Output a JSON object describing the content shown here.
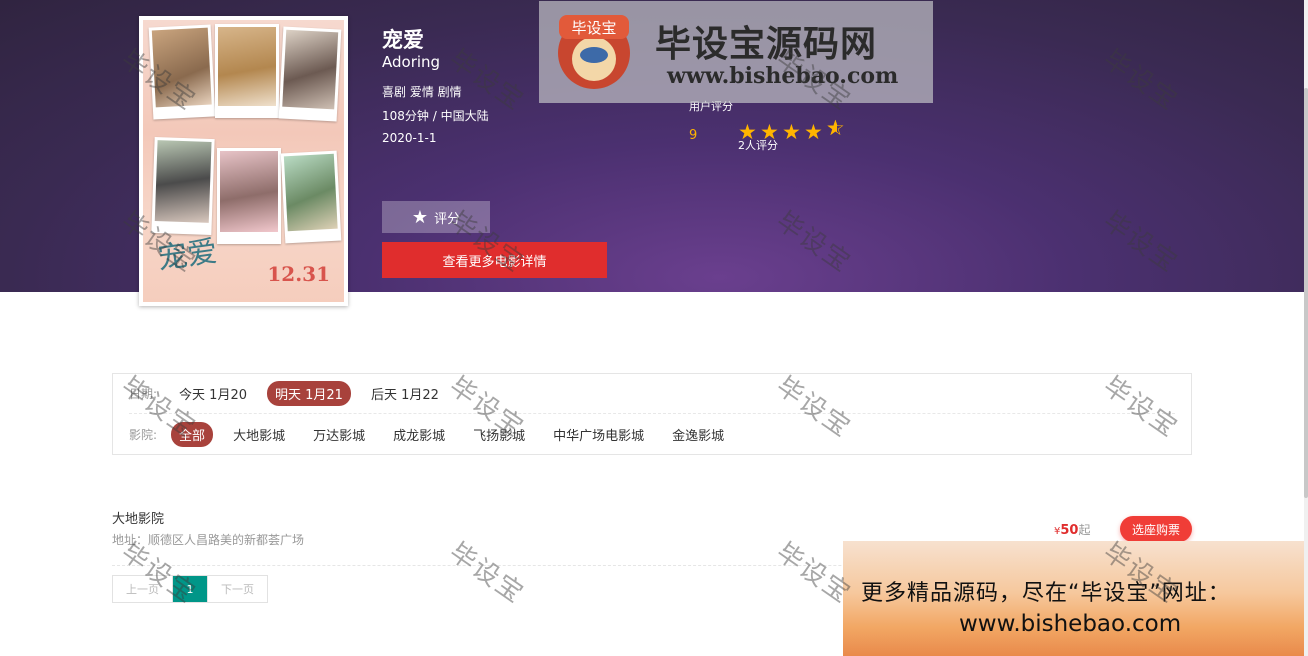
{
  "movie": {
    "title": "宠爱",
    "english_title": "Adoring",
    "genres": "喜剧 爱情 剧情",
    "duration_region": "108分钟 / 中国大陆",
    "release_date": "2020-1-1",
    "poster": {
      "title_text": "宠爱",
      "date_text": "12.31"
    }
  },
  "rating": {
    "label": "用户评分",
    "score": "9",
    "stars": 4.5,
    "count_text": "2人评分"
  },
  "actions": {
    "rate_label": "评分",
    "detail_label": "查看更多电影详情"
  },
  "logo": {
    "badge": "毕设宝",
    "name": "毕设宝源码网",
    "url": "www.bishebao.com"
  },
  "filters": {
    "date_label": "日期:",
    "dates": [
      {
        "label": "今天 1月20",
        "active": false
      },
      {
        "label": "明天 1月21",
        "active": true
      },
      {
        "label": "后天 1月22",
        "active": false
      }
    ],
    "cinema_label": "影院:",
    "cinemas": [
      {
        "label": "全部",
        "active": true
      },
      {
        "label": "大地影城",
        "active": false
      },
      {
        "label": "万达影城",
        "active": false
      },
      {
        "label": "成龙影城",
        "active": false
      },
      {
        "label": "飞扬影城",
        "active": false
      },
      {
        "label": "中华广场电影城",
        "active": false
      },
      {
        "label": "金逸影城",
        "active": false
      }
    ]
  },
  "cinema_list": [
    {
      "name": "大地影院",
      "address": "地址：顺德区人昌路美的新都荟广场",
      "price_prefix": "¥",
      "price": "50",
      "price_suffix": "起",
      "buy_label": "选座购票"
    }
  ],
  "pagination": {
    "prev": "上一页",
    "current": "1",
    "next": "下一页"
  },
  "ad": {
    "line1": "更多精品源码，尽在“毕设宝”网址：",
    "line2": "www.bishebao.com"
  },
  "watermark": "毕设宝",
  "colors": {
    "accent_red": "#e02d2d",
    "active_chip": "#a8423c",
    "page_active": "#009688",
    "star": "#ffb400"
  }
}
